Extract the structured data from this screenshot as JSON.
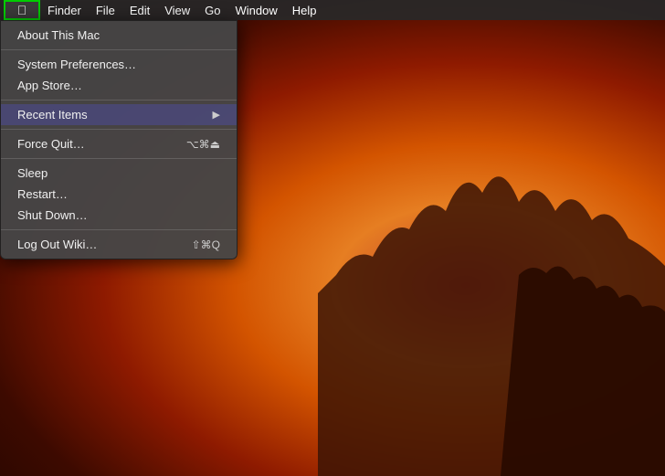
{
  "menubar": {
    "apple_icon": "🍎",
    "items": [
      {
        "label": "Finder",
        "id": "finder"
      },
      {
        "label": "File",
        "id": "file"
      },
      {
        "label": "Edit",
        "id": "edit"
      },
      {
        "label": "View",
        "id": "view"
      },
      {
        "label": "Go",
        "id": "go"
      },
      {
        "label": "Window",
        "id": "window"
      },
      {
        "label": "Help",
        "id": "help"
      }
    ]
  },
  "dropdown": {
    "items": [
      {
        "id": "about",
        "label": "About This Mac",
        "shortcut": "",
        "type": "item",
        "arrow": false
      },
      {
        "id": "separator1",
        "type": "separator"
      },
      {
        "id": "system-prefs",
        "label": "System Preferences…",
        "shortcut": "",
        "type": "item",
        "arrow": false
      },
      {
        "id": "app-store",
        "label": "App Store…",
        "shortcut": "",
        "type": "item",
        "arrow": false
      },
      {
        "id": "separator2",
        "type": "separator"
      },
      {
        "id": "recent-items",
        "label": "Recent Items",
        "shortcut": "▶",
        "type": "item",
        "arrow": true
      },
      {
        "id": "separator3",
        "type": "separator"
      },
      {
        "id": "force-quit",
        "label": "Force Quit…",
        "shortcut": "⌥⌘⏻",
        "type": "item",
        "arrow": false
      },
      {
        "id": "separator4",
        "type": "separator"
      },
      {
        "id": "sleep",
        "label": "Sleep",
        "shortcut": "",
        "type": "item",
        "arrow": false
      },
      {
        "id": "restart",
        "label": "Restart…",
        "shortcut": "",
        "type": "item",
        "arrow": false
      },
      {
        "id": "shut-down",
        "label": "Shut Down…",
        "shortcut": "",
        "type": "item",
        "arrow": false
      },
      {
        "id": "separator5",
        "type": "separator"
      },
      {
        "id": "logout",
        "label": "Log Out Wiki…",
        "shortcut": "⇧⌘Q",
        "type": "item",
        "arrow": false
      }
    ]
  },
  "desktop": {
    "background_description": "Yosemite sunset with red/orange sky and rock silhouette"
  }
}
